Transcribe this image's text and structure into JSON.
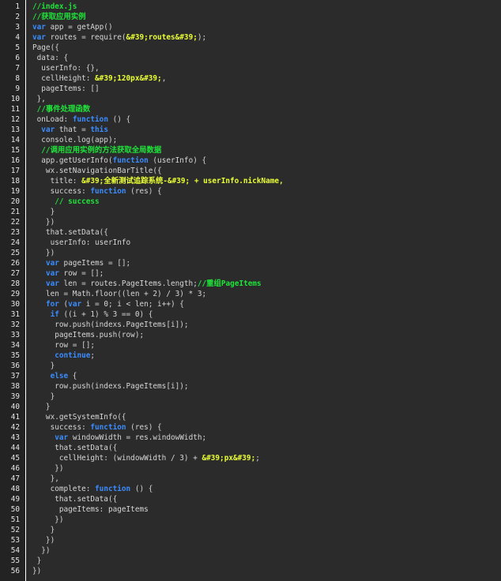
{
  "colors": {
    "background": "#2b2b2b",
    "gutter": "#232323",
    "plain": "#d6d6d6",
    "comment": "#1fe33a",
    "keyword": "#3a8cff",
    "string": "#eaff32"
  },
  "lines": [
    [
      [
        "c",
        "//index.js"
      ]
    ],
    [
      [
        "c",
        "//获取应用实例"
      ]
    ],
    [
      [
        "k",
        "var"
      ],
      [
        "p",
        " app = getApp()"
      ]
    ],
    [
      [
        "k",
        "var"
      ],
      [
        "p",
        " routes = require("
      ],
      [
        "s",
        "&#39;routes&#39;"
      ],
      [
        "p",
        ");"
      ]
    ],
    [
      [
        "p",
        "Page({"
      ]
    ],
    [
      [
        "p",
        " data: {"
      ]
    ],
    [
      [
        "p",
        "  userInfo: {},"
      ]
    ],
    [
      [
        "p",
        "  cellHeight: "
      ],
      [
        "s",
        "&#39;120px&#39;"
      ],
      [
        "p",
        ","
      ]
    ],
    [
      [
        "p",
        "  pageItems: []"
      ]
    ],
    [
      [
        "p",
        " },"
      ]
    ],
    [
      [
        "c",
        " //事件处理函数"
      ]
    ],
    [
      [
        "p",
        " onLoad: "
      ],
      [
        "k",
        "function"
      ],
      [
        "p",
        " () {"
      ]
    ],
    [
      [
        "p",
        "  "
      ],
      [
        "k",
        "var"
      ],
      [
        "p",
        " that = "
      ],
      [
        "k",
        "this"
      ]
    ],
    [
      [
        "p",
        "  console.log(app);"
      ]
    ],
    [
      [
        "c",
        "  //调用应用实例的方法获取全局数据"
      ]
    ],
    [
      [
        "p",
        "  app.getUserInfo("
      ],
      [
        "k",
        "function"
      ],
      [
        "p",
        " (userInfo) {"
      ]
    ],
    [
      [
        "p",
        "   wx.setNavigationBarTitle({"
      ]
    ],
    [
      [
        "p",
        "    title: "
      ],
      [
        "s",
        "&#39;全新测试追踪系统-&#39; + userInfo.nickName,"
      ]
    ],
    [
      [
        "p",
        "    success: "
      ],
      [
        "k",
        "function"
      ],
      [
        "p",
        " (res) {"
      ]
    ],
    [
      [
        "c",
        "     // success"
      ]
    ],
    [
      [
        "p",
        "    }"
      ]
    ],
    [
      [
        "p",
        "   })"
      ]
    ],
    [
      [
        "p",
        "   that.setData({"
      ]
    ],
    [
      [
        "p",
        "    userInfo: userInfo"
      ]
    ],
    [
      [
        "p",
        "   })"
      ]
    ],
    [
      [
        "p",
        "   "
      ],
      [
        "k",
        "var"
      ],
      [
        "p",
        " pageItems = [];"
      ]
    ],
    [
      [
        "p",
        "   "
      ],
      [
        "k",
        "var"
      ],
      [
        "p",
        " row = [];"
      ]
    ],
    [
      [
        "p",
        "   "
      ],
      [
        "k",
        "var"
      ],
      [
        "p",
        " len = routes.PageItems.length;"
      ],
      [
        "c",
        "//重组PageItems"
      ]
    ],
    [
      [
        "p",
        "   len = Math.floor((len + 2) / 3) * 3;"
      ]
    ],
    [
      [
        "p",
        "   "
      ],
      [
        "k",
        "for"
      ],
      [
        "p",
        " ("
      ],
      [
        "k",
        "var"
      ],
      [
        "p",
        " i = 0; i < len; i++) {"
      ]
    ],
    [
      [
        "p",
        "    "
      ],
      [
        "k",
        "if"
      ],
      [
        "p",
        " ((i + 1) % 3 == 0) {"
      ]
    ],
    [
      [
        "p",
        "     row.push(indexs.PageItems[i]);"
      ]
    ],
    [
      [
        "p",
        "     pageItems.push(row);"
      ]
    ],
    [
      [
        "p",
        "     row = [];"
      ]
    ],
    [
      [
        "p",
        "     "
      ],
      [
        "k",
        "continue"
      ],
      [
        "p",
        ";"
      ]
    ],
    [
      [
        "p",
        "    }"
      ]
    ],
    [
      [
        "p",
        "    "
      ],
      [
        "k",
        "else"
      ],
      [
        "p",
        " {"
      ]
    ],
    [
      [
        "p",
        "     row.push(indexs.PageItems[i]);"
      ]
    ],
    [
      [
        "p",
        "    }"
      ]
    ],
    [
      [
        "p",
        "   }"
      ]
    ],
    [
      [
        "p",
        "   wx.getSystemInfo({"
      ]
    ],
    [
      [
        "p",
        "    success: "
      ],
      [
        "k",
        "function"
      ],
      [
        "p",
        " (res) {"
      ]
    ],
    [
      [
        "p",
        "     "
      ],
      [
        "k",
        "var"
      ],
      [
        "p",
        " windowWidth = res.windowWidth;"
      ]
    ],
    [
      [
        "p",
        "     that.setData({"
      ]
    ],
    [
      [
        "p",
        "      cellHeight: (windowWidth / 3) + "
      ],
      [
        "s",
        "&#39;px&#39;"
      ],
      [
        "p",
        ";"
      ]
    ],
    [
      [
        "p",
        "     })"
      ]
    ],
    [
      [
        "p",
        "    },"
      ]
    ],
    [
      [
        "p",
        "    complete: "
      ],
      [
        "k",
        "function"
      ],
      [
        "p",
        " () {"
      ]
    ],
    [
      [
        "p",
        "     that.setData({"
      ]
    ],
    [
      [
        "p",
        "      pageItems: pageItems"
      ]
    ],
    [
      [
        "p",
        "     })"
      ]
    ],
    [
      [
        "p",
        "    }"
      ]
    ],
    [
      [
        "p",
        "   })"
      ]
    ],
    [
      [
        "p",
        "  })"
      ]
    ],
    [
      [
        "p",
        " }"
      ]
    ],
    [
      [
        "p",
        "})"
      ]
    ]
  ]
}
